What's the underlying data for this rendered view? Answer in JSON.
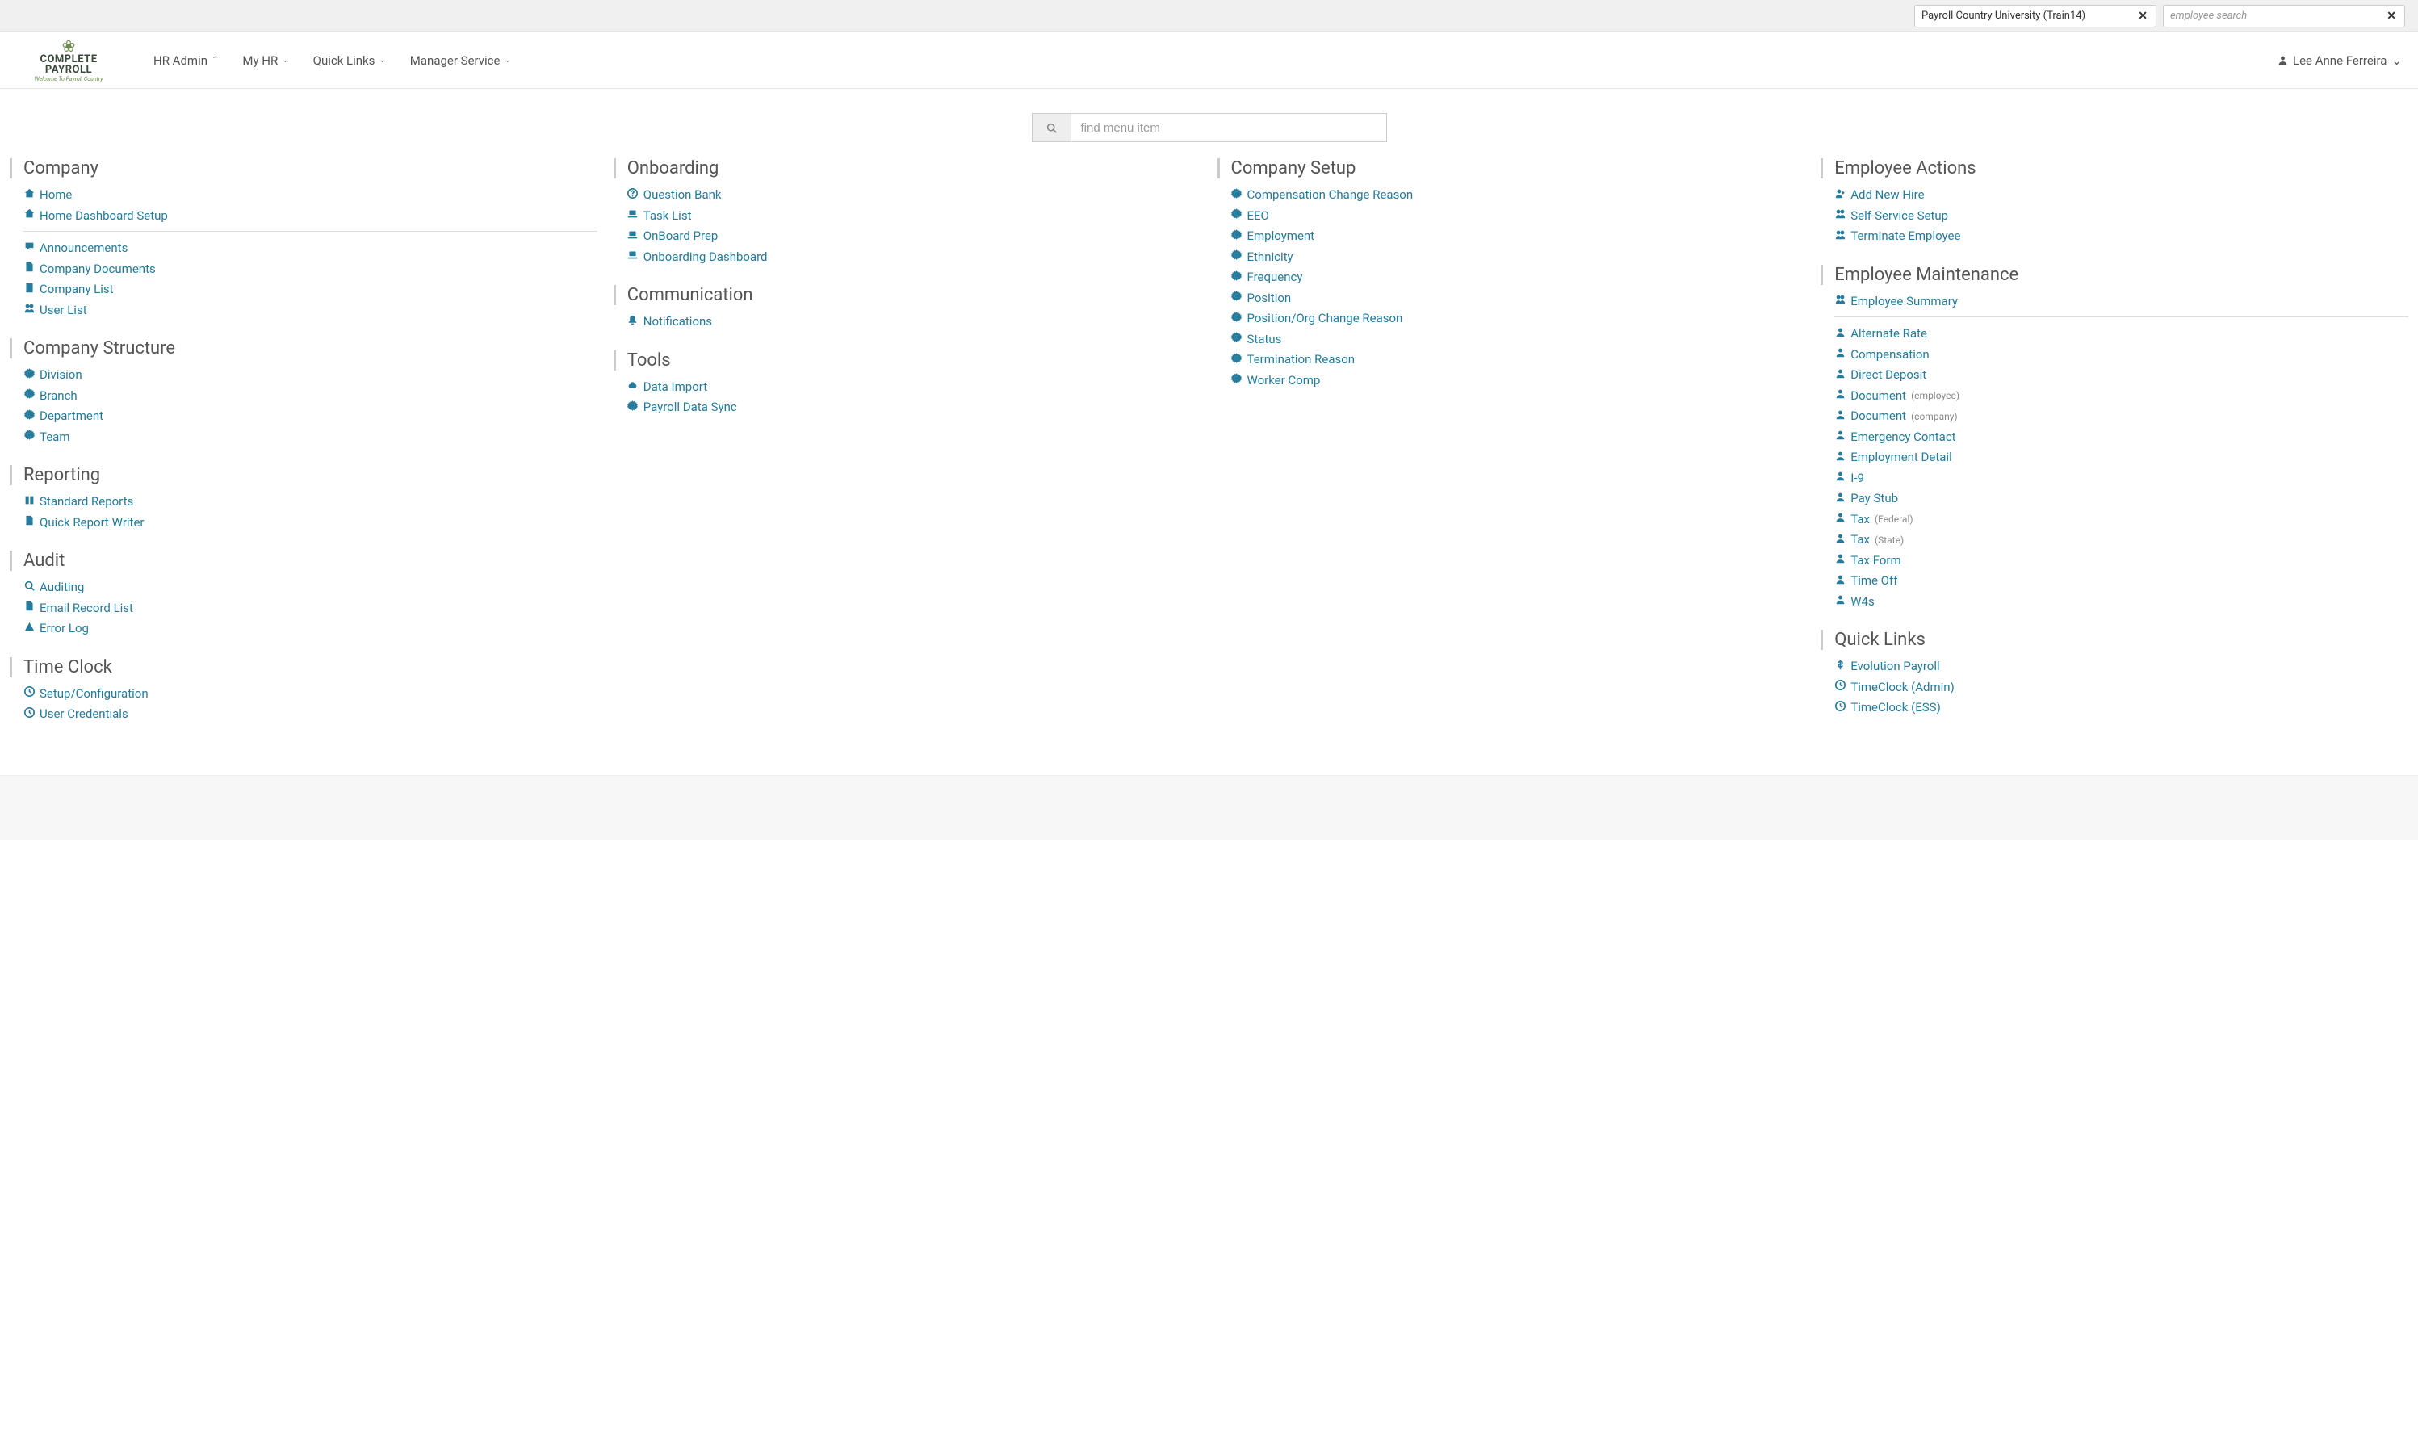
{
  "brand": {
    "line1": "COMPLETE",
    "line2": "PAYROLL",
    "tagline": "Welcome To Payroll Country"
  },
  "utilbar": {
    "company_value": "Payroll Country University (Train14)",
    "employee_placeholder": "employee search"
  },
  "nav": {
    "items": [
      {
        "label": "HR Admin"
      },
      {
        "label": "My HR"
      },
      {
        "label": "Quick Links"
      },
      {
        "label": "Manager Service"
      }
    ],
    "user": "Lee Anne Ferreira"
  },
  "find": {
    "placeholder": "find menu item"
  },
  "sections": {
    "company": {
      "title": "Company",
      "top": [
        {
          "icon": "home",
          "label": "Home"
        },
        {
          "icon": "home",
          "label": "Home Dashboard Setup"
        }
      ],
      "bottom": [
        {
          "icon": "chat",
          "label": "Announcements"
        },
        {
          "icon": "doc",
          "label": "Company Documents"
        },
        {
          "icon": "building",
          "label": "Company List"
        },
        {
          "icon": "users",
          "label": "User List"
        }
      ]
    },
    "structure": {
      "title": "Company Structure",
      "items": [
        {
          "icon": "gear",
          "label": "Division"
        },
        {
          "icon": "gear",
          "label": "Branch"
        },
        {
          "icon": "gear",
          "label": "Department"
        },
        {
          "icon": "gear",
          "label": "Team"
        }
      ]
    },
    "reporting": {
      "title": "Reporting",
      "items": [
        {
          "icon": "book",
          "label": "Standard Reports"
        },
        {
          "icon": "doc",
          "label": "Quick Report Writer"
        }
      ]
    },
    "audit": {
      "title": "Audit",
      "items": [
        {
          "icon": "zoom",
          "label": "Auditing"
        },
        {
          "icon": "doc",
          "label": "Email Record List"
        },
        {
          "icon": "warn",
          "label": "Error Log"
        }
      ]
    },
    "timeclock": {
      "title": "Time Clock",
      "items": [
        {
          "icon": "clock",
          "label": "Setup/Configuration"
        },
        {
          "icon": "clock",
          "label": "User Credentials"
        }
      ]
    },
    "onboarding": {
      "title": "Onboarding",
      "items": [
        {
          "icon": "question",
          "label": "Question Bank"
        },
        {
          "icon": "laptop",
          "label": "Task List"
        },
        {
          "icon": "laptop",
          "label": "OnBoard Prep"
        },
        {
          "icon": "laptop",
          "label": "Onboarding Dashboard"
        }
      ]
    },
    "communication": {
      "title": "Communication",
      "items": [
        {
          "icon": "bell",
          "label": "Notifications"
        }
      ]
    },
    "tools": {
      "title": "Tools",
      "items": [
        {
          "icon": "cloud",
          "label": "Data Import"
        },
        {
          "icon": "gear",
          "label": "Payroll Data Sync"
        }
      ]
    },
    "setup": {
      "title": "Company Setup",
      "items": [
        {
          "icon": "gear",
          "label": "Compensation Change Reason"
        },
        {
          "icon": "gear",
          "label": "EEO"
        },
        {
          "icon": "gear",
          "label": "Employment"
        },
        {
          "icon": "gear",
          "label": "Ethnicity"
        },
        {
          "icon": "gear",
          "label": "Frequency"
        },
        {
          "icon": "gear",
          "label": "Position"
        },
        {
          "icon": "gear",
          "label": "Position/Org Change Reason"
        },
        {
          "icon": "gear",
          "label": "Status"
        },
        {
          "icon": "gear",
          "label": "Termination Reason"
        },
        {
          "icon": "gear",
          "label": "Worker Comp"
        }
      ]
    },
    "actions": {
      "title": "Employee Actions",
      "items": [
        {
          "icon": "userplus",
          "label": "Add New Hire"
        },
        {
          "icon": "users",
          "label": "Self-Service Setup"
        },
        {
          "icon": "users",
          "label": "Terminate Employee"
        }
      ]
    },
    "maintenance": {
      "title": "Employee Maintenance",
      "summary": {
        "icon": "users",
        "label": "Employee Summary"
      },
      "items": [
        {
          "icon": "user",
          "label": "Alternate Rate"
        },
        {
          "icon": "user",
          "label": "Compensation"
        },
        {
          "icon": "user",
          "label": "Direct Deposit"
        },
        {
          "icon": "user",
          "label": "Document",
          "sub": "(employee)"
        },
        {
          "icon": "user",
          "label": "Document",
          "sub": "(company)"
        },
        {
          "icon": "user",
          "label": "Emergency Contact"
        },
        {
          "icon": "user",
          "label": "Employment Detail"
        },
        {
          "icon": "user",
          "label": "I-9"
        },
        {
          "icon": "user",
          "label": "Pay Stub"
        },
        {
          "icon": "user",
          "label": "Tax",
          "sub": "(Federal)"
        },
        {
          "icon": "user",
          "label": "Tax",
          "sub": "(State)"
        },
        {
          "icon": "user",
          "label": "Tax Form"
        },
        {
          "icon": "user",
          "label": "Time Off"
        },
        {
          "icon": "user",
          "label": "W4s"
        }
      ]
    },
    "quicklinks": {
      "title": "Quick Links",
      "items": [
        {
          "icon": "dollar",
          "label": "Evolution Payroll"
        },
        {
          "icon": "clock",
          "label": "TimeClock (Admin)"
        },
        {
          "icon": "clock",
          "label": "TimeClock (ESS)"
        }
      ]
    }
  }
}
